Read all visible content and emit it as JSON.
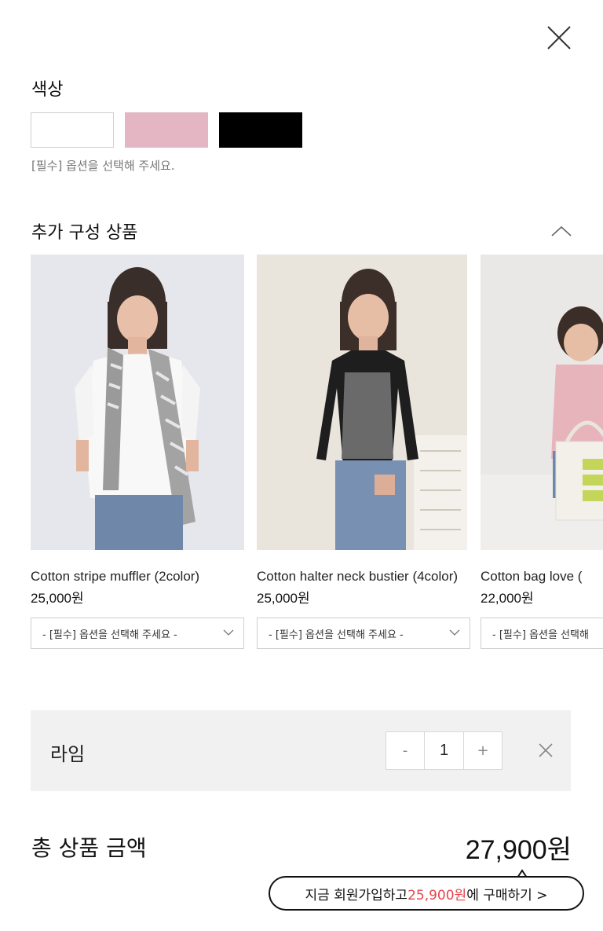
{
  "close_icon": "close-icon",
  "color_section": {
    "title": "색상",
    "swatches": [
      {
        "name": "white",
        "color": "#ffffff"
      },
      {
        "name": "pink",
        "color": "#e4b6c4"
      },
      {
        "name": "black",
        "color": "#000000"
      }
    ],
    "hint": "[필수] 옵션을 선택해 주세요."
  },
  "addon_section": {
    "title": "추가 구성 상품",
    "toggle_icon": "chevron-up-icon",
    "products": [
      {
        "name": "Cotton stripe muffler (2color)",
        "price": "25,000원",
        "select_placeholder": "- [필수] 옵션을 선택해 주세요 -"
      },
      {
        "name": "Cotton halter neck bustier (4color)",
        "price": "25,000원",
        "select_placeholder": "- [필수] 옵션을 선택해 주세요 -"
      },
      {
        "name": "Cotton bag love (",
        "price": "22,000원",
        "select_placeholder": "- [필수] 옵션을 선택해"
      }
    ]
  },
  "selected_item": {
    "name": "라임",
    "minus": "-",
    "quantity": "1",
    "plus": "+"
  },
  "total": {
    "label": "총 상품 금액",
    "value": "27,900원"
  },
  "promo": {
    "prefix": "지금 회원가입하고 ",
    "highlight": "25,900원",
    "suffix": "에 구매하기 >",
    "highlight_color": "#e4464d"
  }
}
